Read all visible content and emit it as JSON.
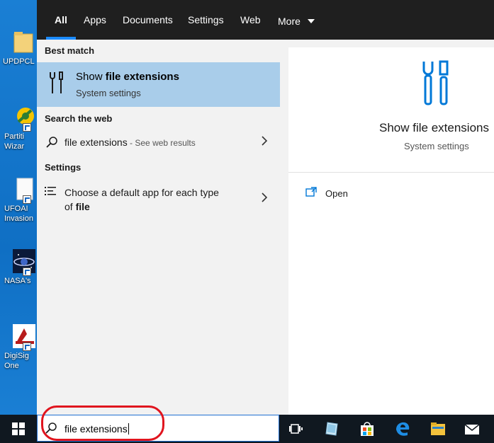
{
  "desktop": {
    "icons": [
      {
        "label": "UPDPCL",
        "icon": "folder-icon"
      },
      {
        "label": "Partiti\nWizar",
        "icon": "partition-wizard-icon"
      },
      {
        "label": "UFOAI\nInvasion",
        "icon": "ufoai-icon"
      },
      {
        "label": "NASA's",
        "icon": "nasa-icon"
      },
      {
        "label": "DigiSig\nOne",
        "icon": "digisig-icon"
      }
    ]
  },
  "nav": {
    "tabs": [
      {
        "label": "All",
        "active": true
      },
      {
        "label": "Apps"
      },
      {
        "label": "Documents"
      },
      {
        "label": "Settings"
      },
      {
        "label": "Web"
      },
      {
        "label": "More"
      }
    ]
  },
  "results": {
    "best_match_header": "Best match",
    "best_match": {
      "title_prefix": "Show ",
      "title_bold": "file extensions",
      "subtitle": "System settings",
      "icon": "settings-tools-icon"
    },
    "web_header": "Search the web",
    "web_item": {
      "query": "file extensions",
      "suffix": " - See web results",
      "icon": "search-icon"
    },
    "settings_header": "Settings",
    "settings_item": {
      "line1": "Choose a default app for each type",
      "line2_prefix": "of ",
      "line2_bold": "file",
      "icon": "list-settings-icon"
    }
  },
  "preview": {
    "title": "Show file extensions",
    "subtitle": "System settings",
    "open_label": "Open",
    "accent": "#0078d7"
  },
  "taskbar": {
    "search_value": "file extensions",
    "icons": [
      "task-view-icon",
      "tablet-app-icon",
      "store-icon",
      "edge-icon",
      "file-explorer-icon",
      "mail-icon"
    ]
  },
  "colors": {
    "selection": "#a9cdea",
    "nav_bg": "#1f1f1f",
    "taskbar_bg": "#101820",
    "highlight_circle": "#e0141e"
  }
}
